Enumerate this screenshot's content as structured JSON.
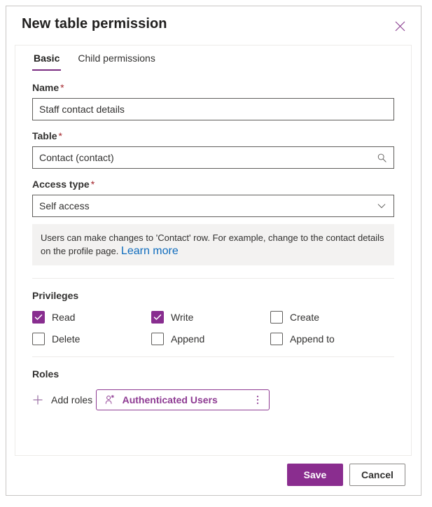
{
  "dialog": {
    "title": "New table permission",
    "close_label": "Close"
  },
  "tabs": [
    {
      "label": "Basic",
      "active": true
    },
    {
      "label": "Child permissions",
      "active": false
    }
  ],
  "fields": {
    "name": {
      "label": "Name",
      "required_marker": "*",
      "value": "Staff contact details"
    },
    "table": {
      "label": "Table",
      "required_marker": "*",
      "value": "Contact (contact)",
      "icon": "search-icon"
    },
    "access_type": {
      "label": "Access type",
      "required_marker": "*",
      "value": "Self access",
      "icon": "chevron-down-icon"
    }
  },
  "info": {
    "text": "Users can make changes to 'Contact' row. For example, change to the contact details on the profile page. ",
    "link_label": "Learn more"
  },
  "privileges": {
    "title": "Privileges",
    "items": [
      {
        "label": "Read",
        "checked": true
      },
      {
        "label": "Write",
        "checked": true
      },
      {
        "label": "Create",
        "checked": false
      },
      {
        "label": "Delete",
        "checked": false
      },
      {
        "label": "Append",
        "checked": false
      },
      {
        "label": "Append to",
        "checked": false
      }
    ]
  },
  "roles": {
    "title": "Roles",
    "add_label": "Add roles",
    "items": [
      {
        "name": "Authenticated Users",
        "icon": "person-icon",
        "menu_icon": "more-vertical-icon"
      }
    ]
  },
  "footer": {
    "save_label": "Save",
    "cancel_label": "Cancel"
  },
  "colors": {
    "accent": "#8a2d8f",
    "tab_underline": "#7a2c81",
    "required": "#a4262c",
    "link": "#0f6cbd",
    "info_bg": "#f3f2f1"
  }
}
